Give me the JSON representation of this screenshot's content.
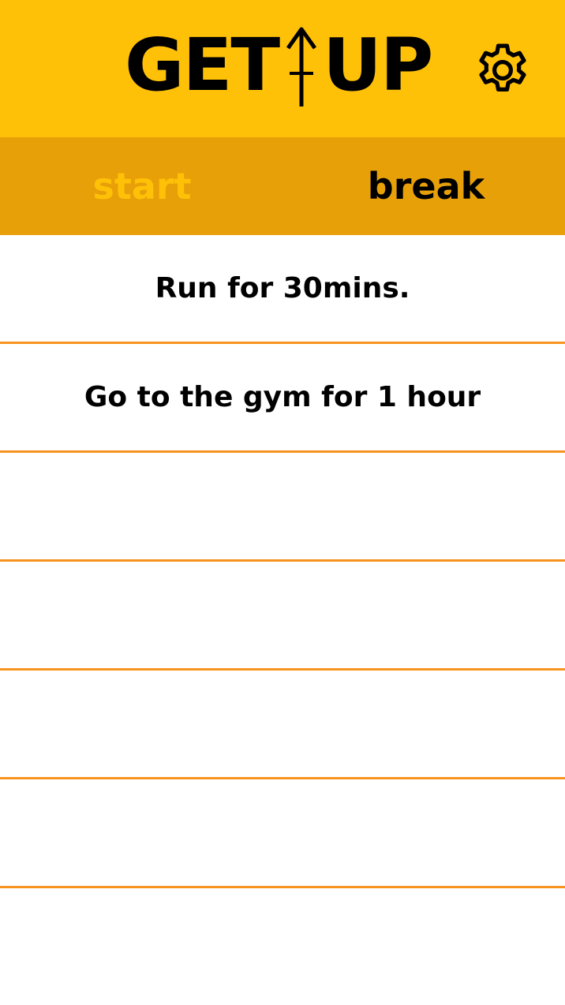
{
  "app": {
    "logo_left": "GET",
    "logo_right": "UP"
  },
  "tabs": [
    {
      "label": "start",
      "color": "#FFC107"
    },
    {
      "label": "break",
      "color": "#000000"
    }
  ],
  "tasks": [
    {
      "text": "Run for 30mins."
    },
    {
      "text": "Go to the gym for 1 hour"
    },
    {
      "text": ""
    },
    {
      "text": ""
    },
    {
      "text": ""
    },
    {
      "text": ""
    }
  ],
  "colors": {
    "header_bg": "#FFC107",
    "tabbar_bg": "#E8A008",
    "row_divider": "#F7931E",
    "active_tab": "#FFC107",
    "inactive_tab": "#000000"
  },
  "icons": {
    "logo_arrow": "arrow-up-icon",
    "settings": "gear-icon"
  }
}
